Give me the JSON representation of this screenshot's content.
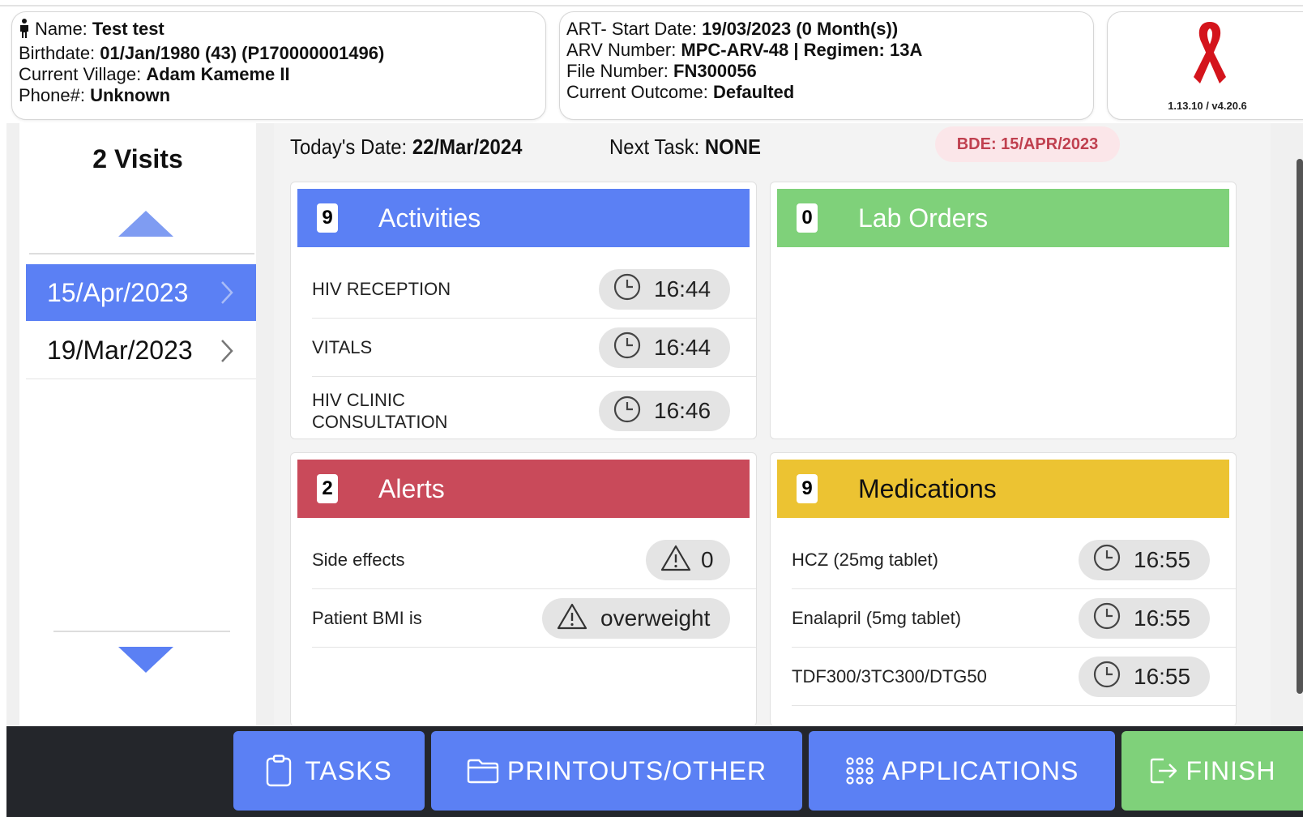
{
  "patient": {
    "name_label": "Name: ",
    "name": "Test test",
    "birthdate_label": "Birthdate: ",
    "birthdate": "01/Jan/1980 (43) (P170000001496)",
    "village_label": "Current Village: ",
    "village": "Adam Kameme II",
    "phone_label": "Phone#: ",
    "phone": "Unknown"
  },
  "program": {
    "art_start_label": "ART- Start Date: ",
    "art_start": "19/03/2023 (0 Month(s))",
    "arv_label": "ARV Number: ",
    "arv": "MPC-ARV-48 | Regimen: 13A",
    "file_label": "File Number: ",
    "file": "FN300056",
    "outcome_label": "Current Outcome: ",
    "outcome": "Defaulted"
  },
  "logo": {
    "version": "1.13.10 / v4.20.6",
    "ribbon_color": "#d4141c"
  },
  "visits": {
    "title": "2 Visits",
    "items": [
      {
        "date": "15/Apr/2023",
        "selected": true
      },
      {
        "date": "19/Mar/2023",
        "selected": false
      }
    ]
  },
  "header": {
    "today_label": "Today's Date: ",
    "today": "22/Mar/2024",
    "next_label": "Next Task: ",
    "next": "NONE",
    "bde": "BDE: 15/APR/2023"
  },
  "activities": {
    "count": "9",
    "title": "Activities",
    "color": "#5b80f4",
    "items": [
      {
        "label": "HIV RECEPTION",
        "time": "16:44"
      },
      {
        "label": "VITALS",
        "time": "16:44"
      },
      {
        "label": "HIV CLINIC CONSULTATION",
        "time": "16:46"
      }
    ]
  },
  "lab_orders": {
    "count": "0",
    "title": "Lab Orders",
    "color": "#7fd17a"
  },
  "alerts": {
    "count": "2",
    "title": "Alerts",
    "color": "#c94a5a",
    "items": [
      {
        "label": "Side effects",
        "value": "0"
      },
      {
        "label": "Patient BMI is",
        "value": "overweight"
      }
    ]
  },
  "medications": {
    "count": "9",
    "title": "Medications",
    "color": "#ecc332",
    "items": [
      {
        "label": "HCZ (25mg tablet)",
        "time": "16:55"
      },
      {
        "label": "Enalapril (5mg tablet)",
        "time": "16:55"
      },
      {
        "label": "TDF300/3TC300/DTG50",
        "time": "16:55"
      }
    ]
  },
  "footer": {
    "tasks": "TASKS",
    "printouts": "PRINTOUTS/OTHER",
    "applications": "APPLICATIONS",
    "finish": "FINISH",
    "button_color": "#5b80f4",
    "finish_color": "#7fd17a"
  }
}
